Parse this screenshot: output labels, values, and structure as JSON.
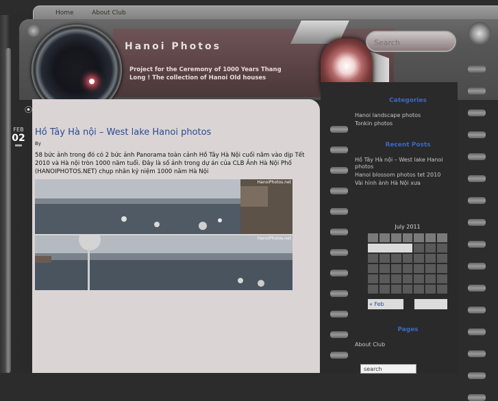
{
  "nav": {
    "items": [
      "Home",
      "About Club"
    ]
  },
  "header": {
    "title": "Hanoi Photos",
    "description": "Project for the Ceremony of 1000 Years Thang Long ! The collection of Hanoi Old houses"
  },
  "search": {
    "placeholder": "Search"
  },
  "post": {
    "date_month": "FEB",
    "date_day": "02",
    "title": "Hồ Tây Hà nội – West lake Hanoi photos",
    "byline": "By",
    "body": "58 bức ảnh trong đó có 2 bức ảnh Panorama toàn cảnh Hồ Tây Hà Nội cuối năm vào dịp Tết 2010 và Hà nội tròn 1000 năm tuổi. Đây là số ảnh trong dự án của CLB Ảnh Hà Nội Phố (HANOIPHOTOS.NET) chụp nhân kỷ niệm 1000 năm Hà Nội",
    "watermark": "HanoiPhotos.net"
  },
  "sidebar": {
    "categories_title": "Categories",
    "categories": [
      "Hanoi landscape photos",
      "Tonkin photos"
    ],
    "recent_title": "Recent Posts",
    "recent": [
      "Hồ Tây Hà nội – West lake Hanoi photos",
      "Hanoi blossom photos tet 2010",
      "Vài hình ảnh Hà Nội xưa"
    ],
    "calendar_title": "July 2011",
    "calendar_prev": "« Feb",
    "pages_title": "Pages",
    "pages": [
      "About Club"
    ],
    "bottom_search": "search"
  },
  "colors": {
    "link": "#2b4a95",
    "heading": "#3b68c4",
    "content_bg": "#dad4d4"
  },
  "icons": {
    "rss": "rss-icon",
    "knob": "knob-icon"
  }
}
